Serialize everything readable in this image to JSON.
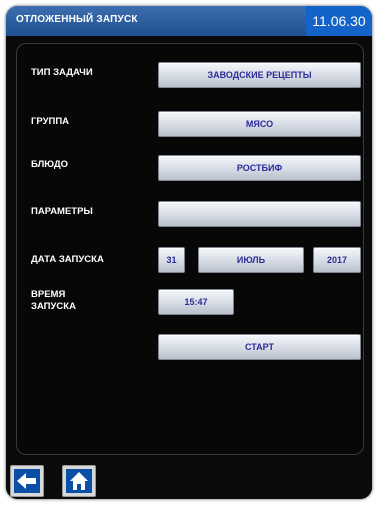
{
  "titlebar": {
    "title": "ОТЛОЖЕННЫЙ ЗАПУСК",
    "clock": "11.06.30"
  },
  "form": {
    "task_type_label": "ТИП ЗАДАЧИ",
    "task_type_value": "ЗАВОДСКИЕ РЕЦЕПТЫ",
    "group_label": "ГРУППА",
    "group_value": "МЯСО",
    "dish_label": "БЛЮДО",
    "dish_value": "РОСТБИФ",
    "params_label": "ПАРАМЕТРЫ",
    "params_value": "",
    "start_date_label": "ДАТА ЗАПУСКА",
    "start_day": "31",
    "start_month": "ИЮЛЬ",
    "start_year": "2017",
    "start_time_label_line1": "ВРЕМЯ",
    "start_time_label_line2": "ЗАПУСКА",
    "start_time": "15:47",
    "start_button": "СТАРТ"
  },
  "icons": {
    "back": "arrow-left-icon",
    "home": "home-icon"
  },
  "colors": {
    "titlebar": "#2a5ca0",
    "clock_bg": "#1463c8",
    "button_text": "#2c2c9a",
    "nav_icon_bg": "#0a4fa6"
  }
}
